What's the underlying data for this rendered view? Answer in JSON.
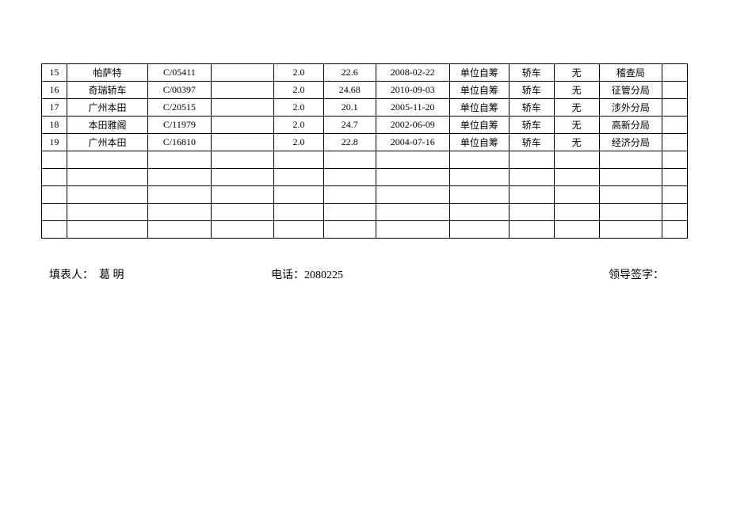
{
  "table": {
    "rows": [
      {
        "idx": "15",
        "name": "帕萨特",
        "code": "C/05411",
        "blank1": "",
        "spec": "2.0",
        "qty": "22.6",
        "date": "2008-02-22",
        "source": "单位自筹",
        "type": "轿车",
        "status": "无",
        "dept": "稽查局"
      },
      {
        "idx": "16",
        "name": "奇瑞轿车",
        "code": "C/00397",
        "blank1": "",
        "spec": "2.0",
        "qty": "24.68",
        "date": "2010-09-03",
        "source": "单位自筹",
        "type": "轿车",
        "status": "无",
        "dept": "征管分局"
      },
      {
        "idx": "17",
        "name": "广州本田",
        "code": "C/20515",
        "blank1": "",
        "spec": "2.0",
        "qty": "20.1",
        "date": "2005-11-20",
        "source": "单位自筹",
        "type": "轿车",
        "status": "无",
        "dept": "涉外分局"
      },
      {
        "idx": "18",
        "name": "本田雅阁",
        "code": "C/11979",
        "blank1": "",
        "spec": "2.0",
        "qty": "24.7",
        "date": "2002-06-09",
        "source": "单位自筹",
        "type": "轿车",
        "status": "无",
        "dept": "高新分局"
      },
      {
        "idx": "19",
        "name": "广州本田",
        "code": "C/16810",
        "blank1": "",
        "spec": "2.0",
        "qty": "22.8",
        "date": "2004-07-16",
        "source": "单位自筹",
        "type": "轿车",
        "status": "无",
        "dept": "经济分局"
      }
    ],
    "emptyRows": 5
  },
  "footer": {
    "fillerLabel": "填表人：",
    "fillerName": "葛 明",
    "phoneLabel": "电话：",
    "phoneValue": "2080225",
    "signLabel": "领导签字："
  }
}
